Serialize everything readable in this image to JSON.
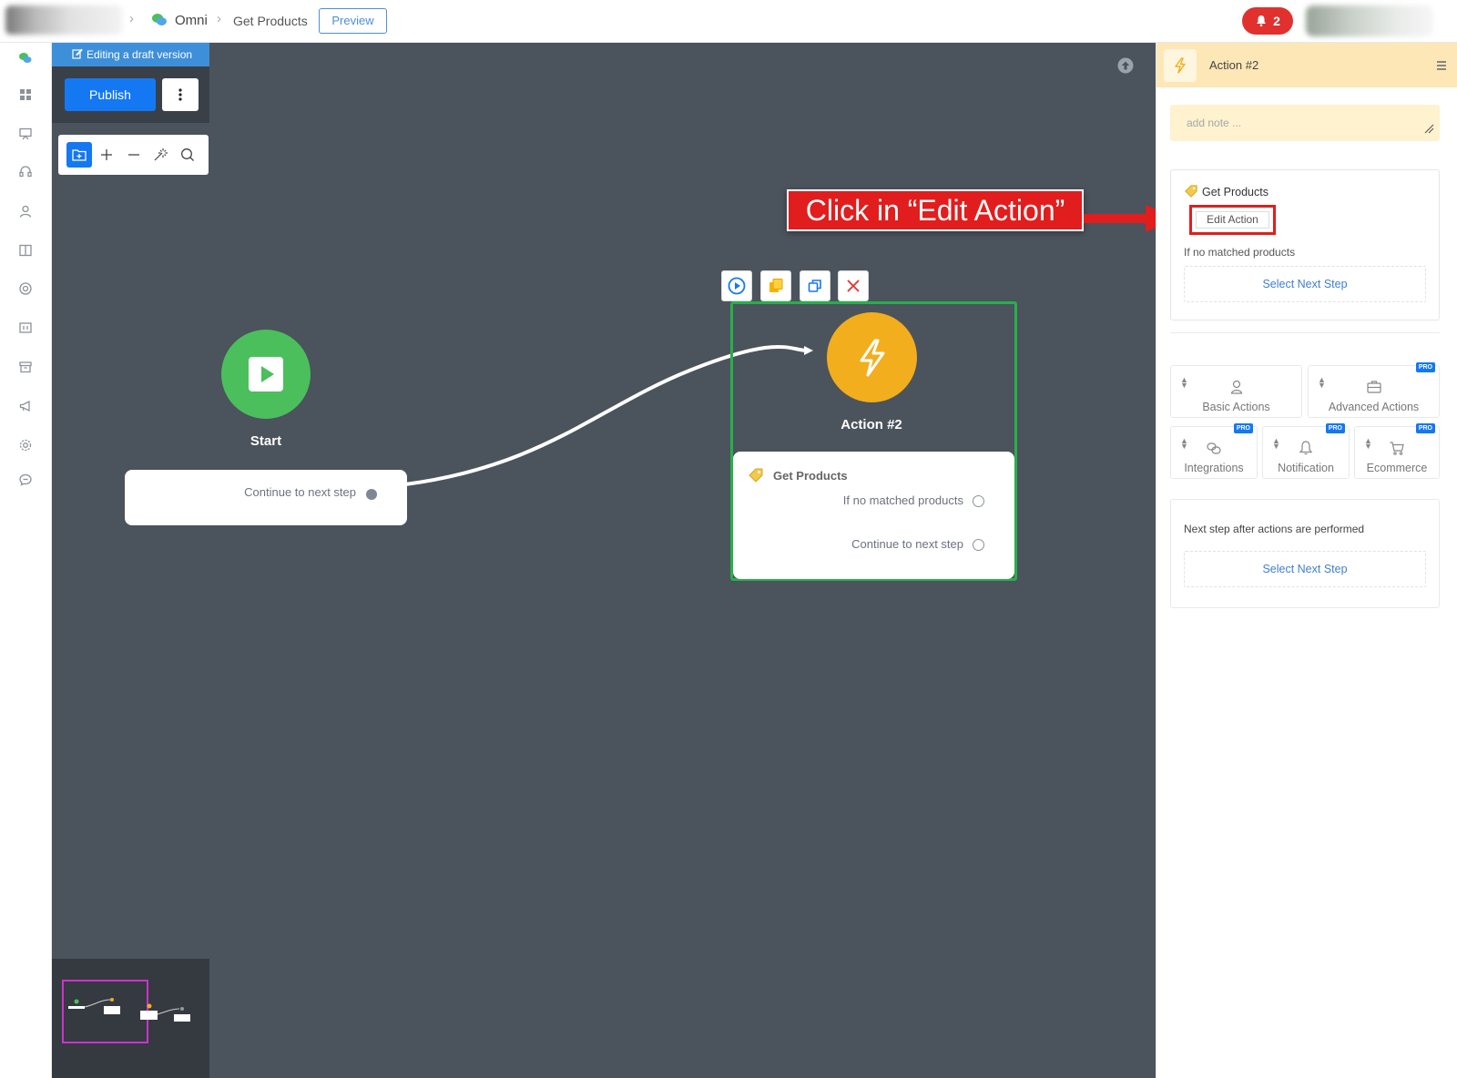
{
  "topbar": {
    "app_name": "Omni",
    "page_name": "Get Products",
    "preview_label": "Preview",
    "notification_count": "2"
  },
  "canvas": {
    "draft_banner": "Editing a draft version",
    "publish_label": "Publish",
    "start_node": {
      "title": "Start",
      "output_label": "Continue to next step"
    },
    "action_node": {
      "title": "Action #2",
      "action_name": "Get Products",
      "outputs": [
        "If no matched products",
        "Continue to next step"
      ]
    },
    "callout_text": "Click in “Edit Action”"
  },
  "panel": {
    "title": "Action #2",
    "note_placeholder": "add note ...",
    "action_card": {
      "name": "Get Products",
      "edit_label": "Edit Action",
      "no_match_label": "If no matched products",
      "select_next_label": "Select Next Step"
    },
    "categories": [
      {
        "label": "Basic Actions",
        "pro": ""
      },
      {
        "label": "Advanced Actions",
        "pro": "PRO"
      },
      {
        "label": "Integrations",
        "pro": "PRO"
      },
      {
        "label": "Notification",
        "pro": "PRO"
      },
      {
        "label": "Ecommerce",
        "pro": "PRO"
      }
    ],
    "next_step": {
      "label": "Next step after actions are performed",
      "select_next_label": "Select Next Step"
    }
  },
  "colors": {
    "canvas_bg": "#4b535c",
    "start_green": "#4bbf5c",
    "action_yellow": "#f2ae1c",
    "selection_green": "#27b04a",
    "primary_blue": "#1478f2",
    "callout_red": "#e21d1d"
  }
}
